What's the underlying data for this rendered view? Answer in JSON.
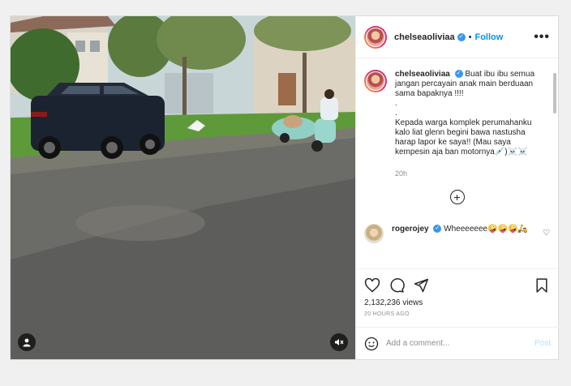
{
  "post": {
    "username": "chelseaoliviaa",
    "follow_label": "Follow",
    "separator": "•",
    "more_label": "•••"
  },
  "caption": {
    "username": "chelseaoliviaa",
    "text": "Buat ibu ibu semua jangan percayain anak main berduaan sama bapaknya !!!!\n.\n.\nKepada warga komplek perumahanku kalo liat glenn begini bawa nastusha harap lapor ke saya!! (Mau saya kempesin aja ban motornya💉)☠️☠️",
    "age": "20h"
  },
  "comments": [
    {
      "username": "rogerojey",
      "text": "Wheeeeeee🤪🤪🤪🛵",
      "like_icon": "heart-outline"
    }
  ],
  "stats": {
    "views": "2,132,236 views",
    "posted": "20 HOURS AGO"
  },
  "composer": {
    "placeholder": "Add a comment...",
    "post_label": "Post"
  },
  "icons": [
    "heart-icon",
    "comment-icon",
    "share-icon",
    "bookmark-icon",
    "emoji-icon",
    "user-tag-icon",
    "mute-icon",
    "load-more-icon"
  ],
  "colors": {
    "accent": "#0095f6",
    "post_disabled": "#b2dffc",
    "verified": "#3897f0"
  }
}
